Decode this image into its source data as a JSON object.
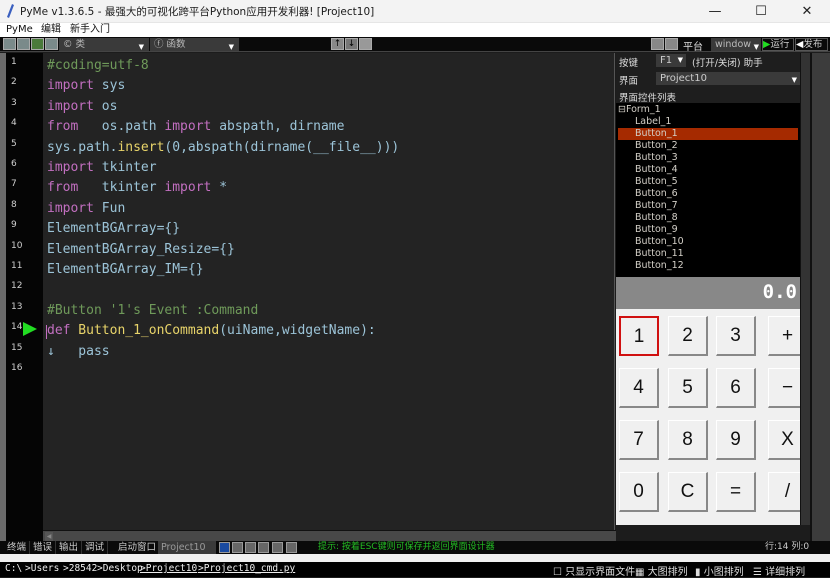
{
  "window": {
    "title": "PyMe v1.3.6.5 -  最强大的可视化跨平台Python应用开发利器!   [Project10]",
    "controls": {
      "minimize": "—",
      "maximize": "☐",
      "close": "✕"
    }
  },
  "menu": [
    "PyMe",
    "编辑",
    "新手入门"
  ],
  "toolbar": {
    "class_combo": "© 类",
    "function_combo": "ⓕ 函数",
    "platform_label": "平台",
    "platform_value": "window",
    "run_label": "运行",
    "publish_label": "发布"
  },
  "editor": {
    "line_numbers": [
      "1",
      "2",
      "3",
      "4",
      "5",
      "6",
      "7",
      "8",
      "9",
      "10",
      "11",
      "12",
      "13",
      "14",
      "15",
      "16"
    ],
    "lines": [
      [
        {
          "t": "#coding=utf-8",
          "c": "cm"
        }
      ],
      [
        {
          "t": "import",
          "c": "kw"
        },
        {
          "t": " sys",
          "c": "nm"
        }
      ],
      [
        {
          "t": "import",
          "c": "kw"
        },
        {
          "t": " os",
          "c": "nm"
        }
      ],
      [
        {
          "t": "from",
          "c": "kw"
        },
        {
          "t": "   os.path ",
          "c": "nm"
        },
        {
          "t": "import",
          "c": "kw"
        },
        {
          "t": " abspath, dirname",
          "c": "nm"
        }
      ],
      [
        {
          "t": "sys.path.",
          "c": "nm"
        },
        {
          "t": "insert",
          "c": "fn"
        },
        {
          "t": "(0,abspath(dirname(__file__)))",
          "c": "nm"
        }
      ],
      [
        {
          "t": "import",
          "c": "kw"
        },
        {
          "t": " tkinter",
          "c": "nm"
        }
      ],
      [
        {
          "t": "from",
          "c": "kw"
        },
        {
          "t": "   tkinter ",
          "c": "nm"
        },
        {
          "t": "import",
          "c": "kw"
        },
        {
          "t": " *",
          "c": "nm"
        }
      ],
      [
        {
          "t": "import",
          "c": "kw"
        },
        {
          "t": " Fun",
          "c": "nm"
        }
      ],
      [
        {
          "t": "ElementBGArray={}",
          "c": "nm"
        }
      ],
      [
        {
          "t": "ElementBGArray_Resize={}",
          "c": "nm"
        }
      ],
      [
        {
          "t": "ElementBGArray_IM={}",
          "c": "nm"
        }
      ],
      [],
      [
        {
          "t": "#Button '1's Event :Command",
          "c": "cm"
        }
      ],
      [
        {
          "t": "def",
          "c": "kw"
        },
        {
          "t": " Button_1_onCommand",
          "c": "fn"
        },
        {
          "t": "(uiName,widgetName):",
          "c": "nm"
        }
      ],
      [
        {
          "t": "↓   pass",
          "c": "nm"
        }
      ],
      []
    ],
    "current_line": 14
  },
  "right_panel": {
    "hotkey_label": "按键",
    "hotkey_value": "F1",
    "hotkey_desc": "(打开/关闭) 助手",
    "ui_label": "界面",
    "ui_value": "Project10",
    "widget_list_title": "界面控件列表",
    "tree": [
      {
        "label": "⊟Form_1",
        "level": 0,
        "selected": false
      },
      {
        "label": "Label_1",
        "level": 1,
        "selected": false
      },
      {
        "label": "Button_1",
        "level": 1,
        "selected": true
      },
      {
        "label": "Button_2",
        "level": 1,
        "selected": false
      },
      {
        "label": "Button_3",
        "level": 1,
        "selected": false
      },
      {
        "label": "Button_4",
        "level": 1,
        "selected": false
      },
      {
        "label": "Button_5",
        "level": 1,
        "selected": false
      },
      {
        "label": "Button_6",
        "level": 1,
        "selected": false
      },
      {
        "label": "Button_7",
        "level": 1,
        "selected": false
      },
      {
        "label": "Button_8",
        "level": 1,
        "selected": false
      },
      {
        "label": "Button_9",
        "level": 1,
        "selected": false
      },
      {
        "label": "Button_10",
        "level": 1,
        "selected": false
      },
      {
        "label": "Button_11",
        "level": 1,
        "selected": false
      },
      {
        "label": "Button_12",
        "level": 1,
        "selected": false
      }
    ]
  },
  "calculator": {
    "display": "0.0",
    "keys": [
      [
        "1",
        "2",
        "3",
        "+"
      ],
      [
        "4",
        "5",
        "6",
        "−"
      ],
      [
        "7",
        "8",
        "9",
        "X"
      ],
      [
        "0",
        "C",
        "=",
        "/"
      ]
    ],
    "focused_key": "1"
  },
  "bottom": {
    "tabs": [
      "终端",
      "错误",
      "输出",
      "调试"
    ],
    "startup_label": "启动窗口",
    "startup_value": "Project10",
    "hint": "提示: 按着ESC键则可保存并返回界面设计器",
    "line_col": "行:14 列:0",
    "path": [
      "C:\\",
      ">Users",
      ">28542",
      ">Desktop",
      ">Project10",
      ">Project10_cmd.py"
    ],
    "only_ui_files": "只显示界面文件",
    "view_large": "大图排列",
    "view_small": "小图排列",
    "view_detail": "详细排列"
  },
  "colors": {
    "accent_run": "#22dd22",
    "selected_tree": "#a52a00",
    "focus_border": "#d01010",
    "editor_bg": "#232323"
  }
}
